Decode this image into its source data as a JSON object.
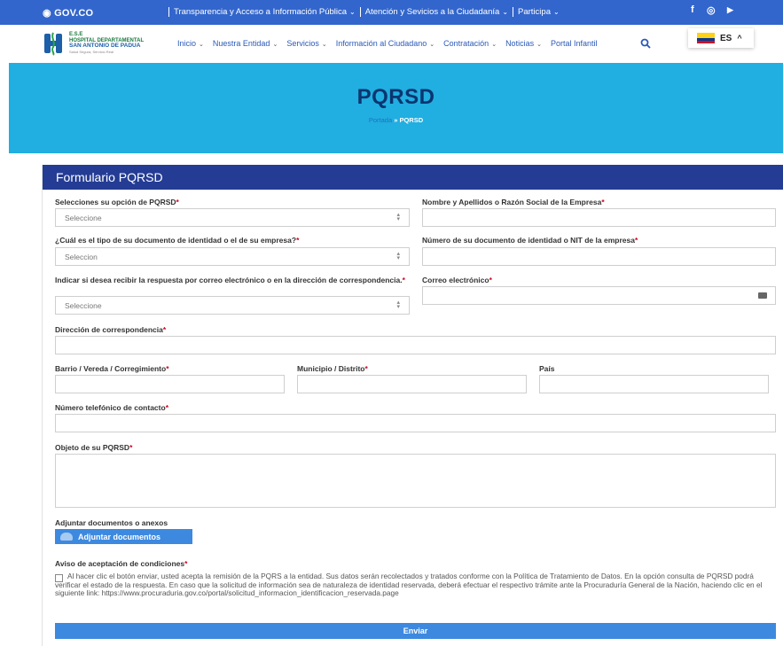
{
  "gov": {
    "logo": "GOV.CO",
    "links": [
      "Transparencia y Acceso a Información Pública",
      "Atención y Sevicios a la Ciudadanía",
      "Participa"
    ],
    "social": {
      "facebook": "f",
      "instagram": "◎",
      "youtube": "▶"
    }
  },
  "header": {
    "logo_line1": "E.S.E",
    "logo_line2": "HOSPITAL DEPARTAMENTAL",
    "logo_line3": "SAN ANTONIO DE PADUA",
    "logo_line4": "Salud Segura, Servicio Real",
    "nav": [
      "Inicio",
      "Nuestra Entidad",
      "Servicios",
      "Información al Ciudadano",
      "Contratación",
      "Noticias",
      "Portal Infantil"
    ],
    "nav_has_chevron": [
      true,
      true,
      true,
      true,
      true,
      true,
      false
    ],
    "language": "ES",
    "language_chevron": "^"
  },
  "hero": {
    "title": "PQRSD",
    "breadcrumb_home": "Portada",
    "breadcrumb_sep": " » ",
    "breadcrumb_current": "PQRSD"
  },
  "form": {
    "title": "Formulario PQRSD",
    "pqrsd_option_label": "Selecciones su opción de PQRSD",
    "pqrsd_option_value": "Seleccione",
    "name_label": "Nombre y Apellidos o Razón Social de la Empresa",
    "doc_type_label": "¿Cuál es el tipo de su documento de identidad o el de su empresa?",
    "doc_type_value": "Seleccion",
    "doc_number_label": "Número de su documento de identidad o NIT de la empresa",
    "response_mode_label": "Indicar si desea recibir la respuesta por correo electrónico o en la dirección de correspondencia.",
    "response_mode_value": "Seleccione",
    "email_label": "Correo electrónico",
    "address_label": "Dirección de correspondencia",
    "neighborhood_label": "Barrio / Vereda / Corregimiento",
    "municipality_label": "Municipio / Distrito",
    "country_label": "País",
    "phone_label": "Número telefónico de contacto",
    "object_label": "Objeto de su PQRSD",
    "attachments_label": "Adjuntar documentos o anexos",
    "attachments_button": "Adjuntar documentos",
    "terms_label": "Aviso de aceptación de condiciones",
    "terms_text": "Al hacer clic el botón enviar, usted acepta la remisión de la PQRS a la entidad. Sus datos serán recolectados y tratados conforme con la Política de Tratamiento de Datos. En la opción consulta de PQRSD podrá verificar el estado de la respuesta. En caso que la solicitud de información sea de naturaleza de identidad reservada, deberá efectuar el respectivo trámite ante la Procuraduría General de la Nación, haciendo clic en el siguiente link: https://www.procuraduria.gov.co/portal/solicitud_informacion_identificacion_reservada.page",
    "required_mark": "*",
    "submit": "Enviar"
  },
  "colors": {
    "gov_blue": "#3366cc",
    "hero_cyan": "#21aee0",
    "panel_navy": "#243c94",
    "button_blue": "#3d89e0",
    "required_red": "#d0021b"
  }
}
